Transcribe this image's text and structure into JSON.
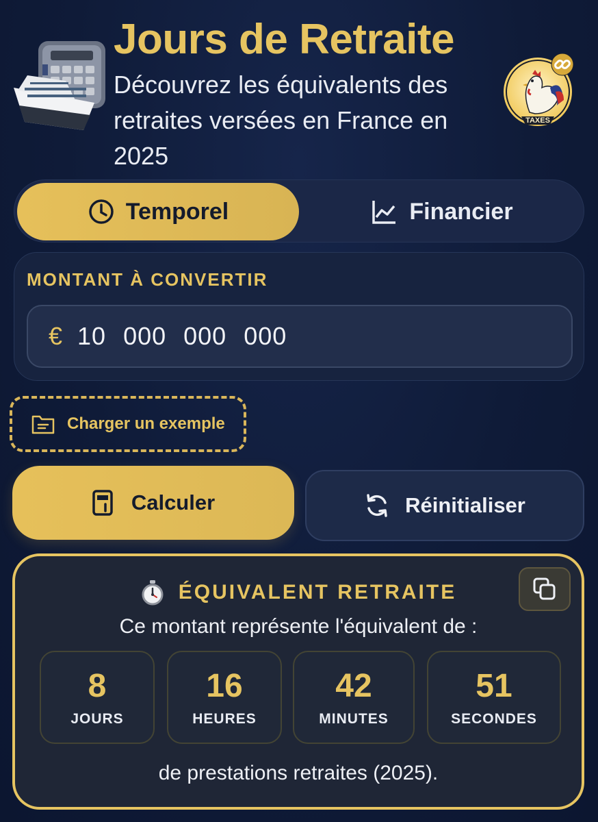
{
  "header": {
    "title": "Jours de Retraite",
    "subtitle": "Découvrez les équivalents des retraites versées en France en 2025",
    "badge_text": "TAXES"
  },
  "tabs": [
    {
      "label": "Temporel",
      "icon": "clock-icon",
      "active": true
    },
    {
      "label": "Financier",
      "icon": "chart-line-icon",
      "active": false
    }
  ],
  "amount": {
    "label": "MONTANT À CONVERTIR",
    "currency": "€",
    "value": "10 000 000 000"
  },
  "example_button": {
    "label": "Charger un exemple",
    "icon": "folder-icon"
  },
  "actions": {
    "calculate_label": "Calculer",
    "calculate_icon": "calculator-icon",
    "reset_label": "Réinitialiser",
    "reset_icon": "refresh-icon"
  },
  "result": {
    "title": "ÉQUIVALENT RETRAITE",
    "icon": "stopwatch-icon",
    "description": "Ce montant représente l'équivalent de :",
    "units": [
      {
        "value": "8",
        "label": "JOURS"
      },
      {
        "value": "16",
        "label": "HEURES"
      },
      {
        "value": "42",
        "label": "MINUTES"
      },
      {
        "value": "51",
        "label": "SECONDES"
      }
    ],
    "footer": "de prestations retraites (2025)."
  },
  "colors": {
    "gold": "#e6c461",
    "background": "#0f1b38",
    "panel": "#17233f",
    "text": "#e9ecf3"
  }
}
